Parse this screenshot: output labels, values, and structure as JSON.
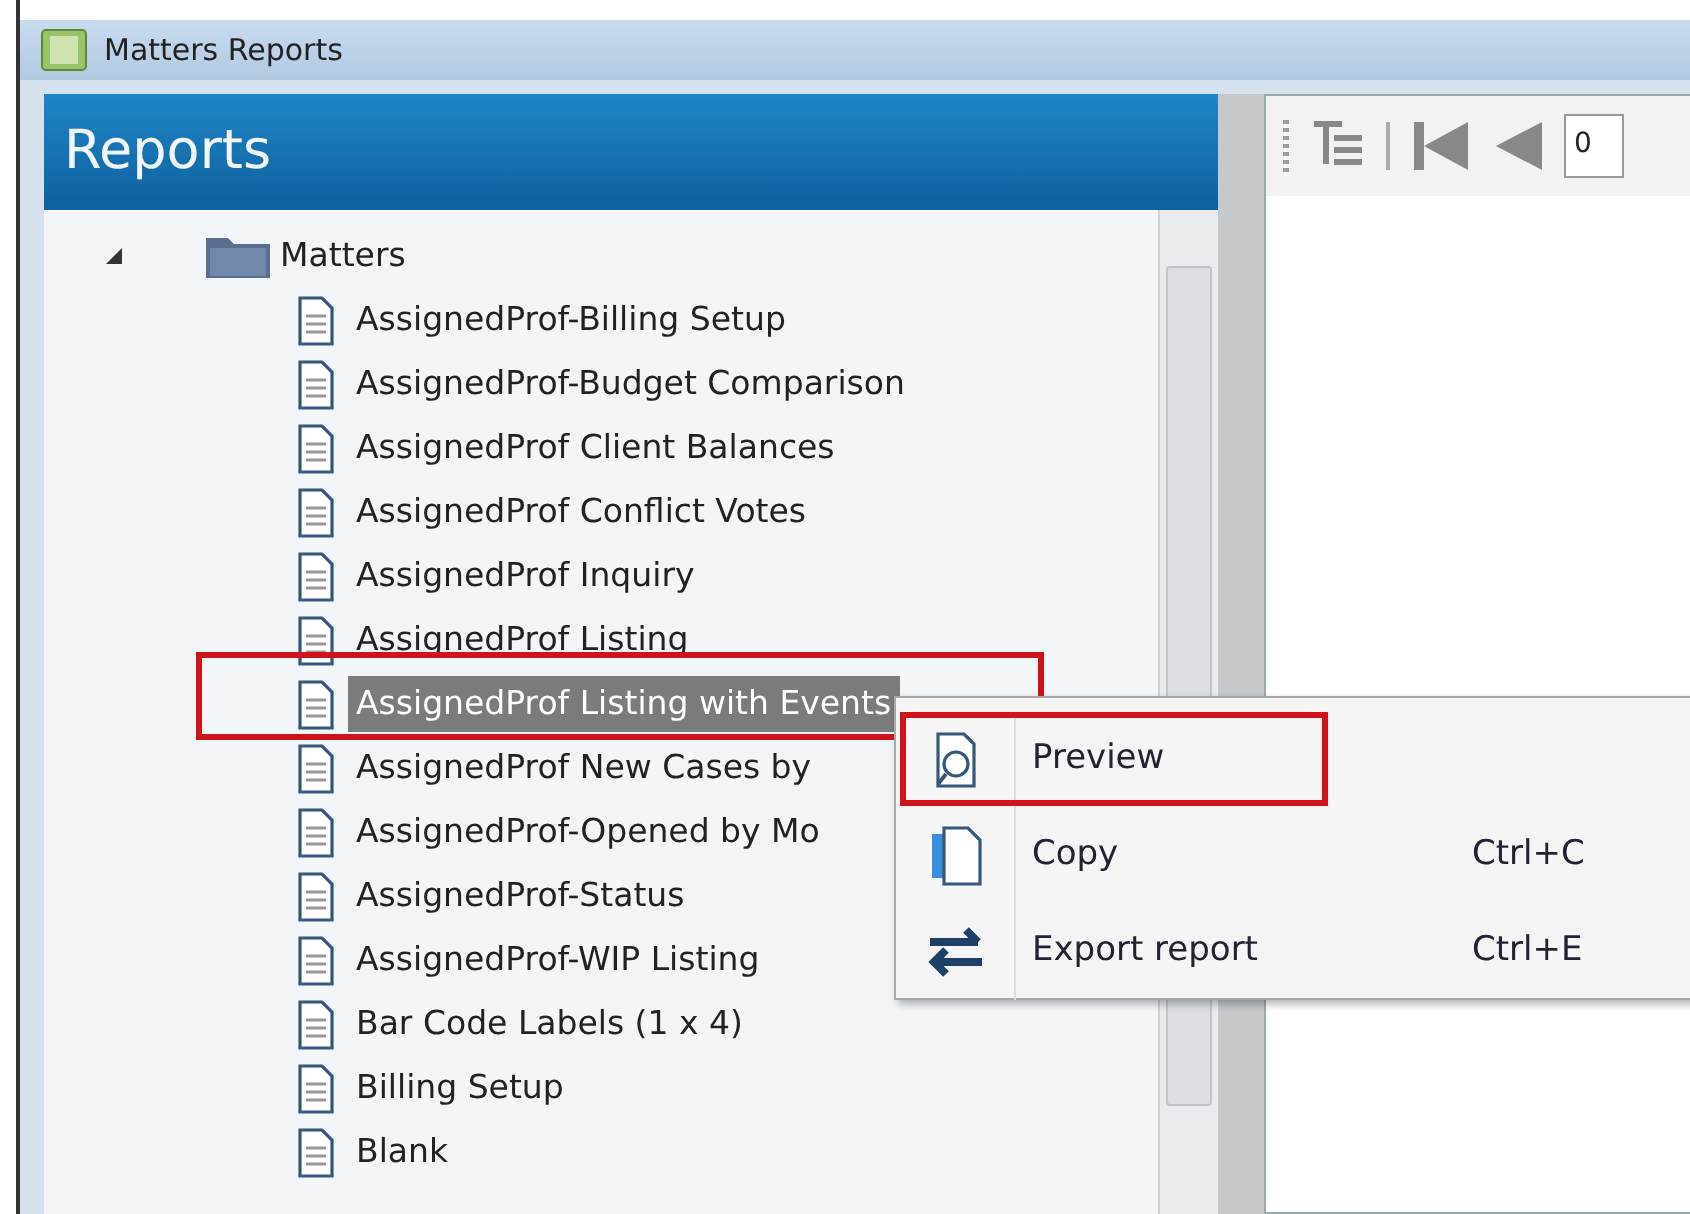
{
  "window": {
    "title": "Matters Reports"
  },
  "panel": {
    "title": "Reports"
  },
  "tree": [
    {
      "label": "Matters",
      "expanded": true,
      "children": [
        {
          "label": "AssignedProf-Billing Setup",
          "selected": false,
          "highlighted": false
        },
        {
          "label": "AssignedProf-Budget Comparison",
          "selected": false,
          "highlighted": false
        },
        {
          "label": "AssignedProf Client Balances",
          "selected": false,
          "highlighted": false
        },
        {
          "label": "AssignedProf Conflict Votes",
          "selected": false,
          "highlighted": false
        },
        {
          "label": "AssignedProf Inquiry",
          "selected": false,
          "highlighted": false
        },
        {
          "label": "AssignedProf Listing",
          "selected": false,
          "highlighted": false
        },
        {
          "label": "AssignedProf Listing with Events",
          "selected": true,
          "highlighted": true
        },
        {
          "label": "AssignedProf New Cases by",
          "selected": false,
          "highlighted": false
        },
        {
          "label": "AssignedProf-Opened by Mo",
          "selected": false,
          "highlighted": false
        },
        {
          "label": "AssignedProf-Status",
          "selected": false,
          "highlighted": false
        },
        {
          "label": "AssignedProf-WIP Listing",
          "selected": false,
          "highlighted": false
        },
        {
          "label": "Bar Code Labels (1 x 4)",
          "selected": false,
          "highlighted": false
        },
        {
          "label": "Billing Setup",
          "selected": false,
          "highlighted": false
        },
        {
          "label": "Blank",
          "selected": false,
          "highlighted": false
        }
      ]
    }
  ],
  "toolbar": {
    "page": "0"
  },
  "context_menu": {
    "items": [
      {
        "kind": "preview",
        "label": "Preview",
        "highlighted": true
      },
      {
        "kind": "copy",
        "label": "Copy",
        "shortcut": "Ctrl+C",
        "highlighted": false
      },
      {
        "kind": "export",
        "label": "Export report",
        "shortcut": "Ctrl+E",
        "highlighted": false
      }
    ]
  }
}
